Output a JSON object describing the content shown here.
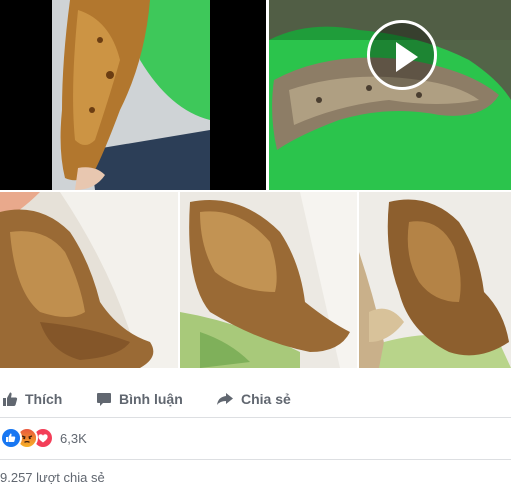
{
  "post": {
    "photos": [
      {
        "name": "photo-1",
        "kind": "image"
      },
      {
        "name": "video-thumbnail",
        "kind": "video"
      },
      {
        "name": "photo-3",
        "kind": "image"
      },
      {
        "name": "photo-4",
        "kind": "image"
      },
      {
        "name": "photo-5",
        "kind": "image"
      }
    ]
  },
  "actions": {
    "like_label": "Thích",
    "comment_label": "Bình luận",
    "share_label": "Chia sẻ"
  },
  "reactions": {
    "icons": [
      "like-icon",
      "angry-icon",
      "love-icon"
    ],
    "count": "6,3K"
  },
  "shares": {
    "text": "9.257 lượt chia sẻ"
  },
  "colors": {
    "action_text": "#616770",
    "like_blue": "#1877f2",
    "love_red": "#f33e58",
    "angry_orange": "#f7714b",
    "divider": "#dddfe2"
  }
}
